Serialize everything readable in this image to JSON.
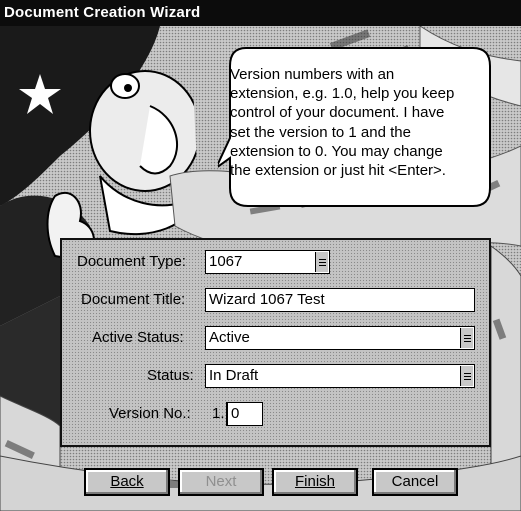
{
  "window": {
    "title": "Document Creation Wizard"
  },
  "bubble": {
    "lines": [
      "Version numbers with an",
      "extension, e.g. 1.0, help you keep",
      "control of your document.  I have",
      "set the version to 1 and the",
      "extension to 0. You may change",
      "the extension or just hit <Enter>."
    ]
  },
  "form": {
    "document_type": {
      "label": "Document Type:",
      "value": "1067"
    },
    "document_title": {
      "label": "Document Title:",
      "value": "Wizard 1067 Test"
    },
    "active_status": {
      "label": "Active Status:",
      "value": "Active"
    },
    "status": {
      "label": "Status:",
      "value": "In Draft"
    },
    "version": {
      "label": "Version No.:",
      "prefix": "1.",
      "value": "0"
    }
  },
  "buttons": {
    "back": "Back",
    "next": "Next",
    "finish": "Finish",
    "cancel": "Cancel"
  }
}
